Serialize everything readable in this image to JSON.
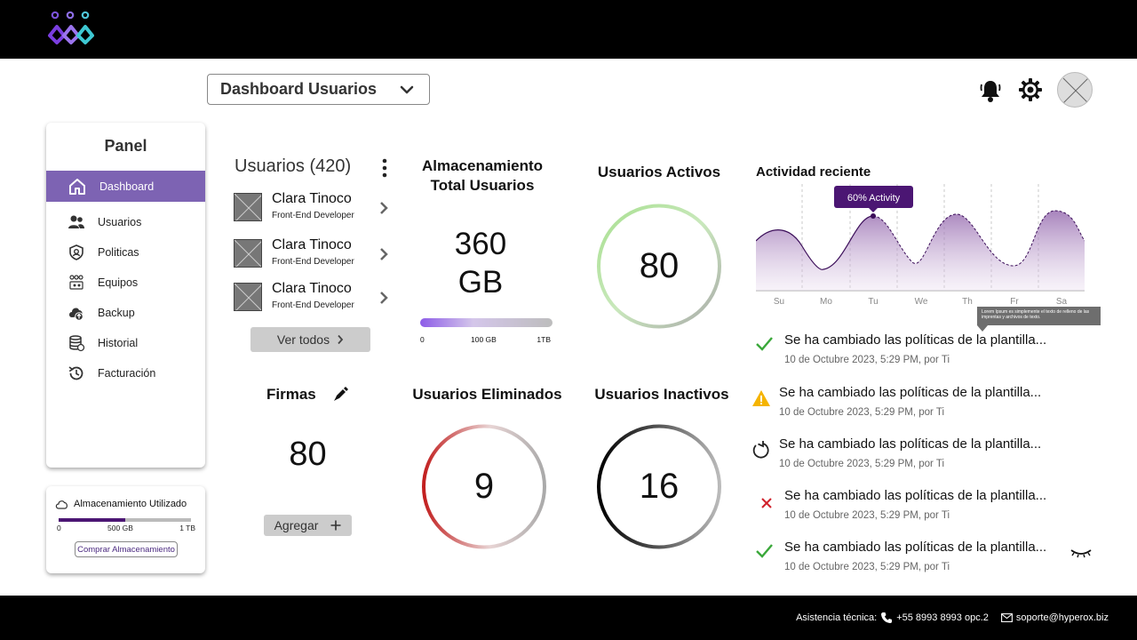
{
  "header": {
    "logo_icon": "people-logo-icon",
    "dashboard_select": "Dashboard Usuarios",
    "icons": [
      "bell-icon",
      "gear-icon",
      "avatar"
    ]
  },
  "sidebar": {
    "title": "Panel",
    "items": [
      {
        "label": "Dashboard",
        "icon": "home-icon",
        "active": true
      },
      {
        "label": "Usuarios",
        "icon": "users-icon"
      },
      {
        "label": "Politicas",
        "icon": "shield-icon"
      },
      {
        "label": "Equipos",
        "icon": "team-icon"
      },
      {
        "label": "Backup",
        "icon": "cloud-upload-icon"
      },
      {
        "label": "Historial",
        "icon": "database-icon"
      },
      {
        "label": "Facturación",
        "icon": "history-icon"
      }
    ]
  },
  "storage_used": {
    "title": "Almacenamiento Utilizado",
    "fill_fraction": 0.5,
    "ticks": [
      "0",
      "500 GB",
      "1 TB"
    ],
    "button": "Comprar Almacenamiento"
  },
  "users": {
    "title": "Usuarios (420)",
    "list": [
      {
        "name": "Clara Tinoco",
        "role": "Front-End Developer"
      },
      {
        "name": "Clara Tinoco",
        "role": "Front-End Developer"
      },
      {
        "name": "Clara Tinoco",
        "role": "Front-End Developer"
      }
    ],
    "view_all": "Ver todos"
  },
  "storage_total": {
    "title_line1": "Almacenamiento",
    "title_line2": "Total Usuarios",
    "value_line1": "360",
    "value_line2": "GB",
    "ticks": [
      "0",
      "100 GB",
      "1TB"
    ]
  },
  "active_users": {
    "title": "Usuarios Activos",
    "value": "80",
    "fraction": 1.0
  },
  "signatures": {
    "title": "Firmas",
    "value": "80",
    "button": "Agregar"
  },
  "deleted_users": {
    "title": "Usuarios Eliminados",
    "value": "9"
  },
  "inactive_users": {
    "title": "Usuarios Inactivos",
    "value": "16"
  },
  "activity": {
    "title": "Actividad reciente",
    "days": [
      "Su",
      "Mo",
      "Tu",
      "We",
      "Th",
      "Fr",
      "Sa"
    ],
    "tooltip": "60% Activity",
    "hint": "Lorem Ipsum es simplemente el texto de relleno de las imprentas y archivos de texto.",
    "log": [
      {
        "icon": "check-icon",
        "text": "Se ha cambiado las políticas de la plantilla...",
        "date": "10 de Octubre 2023, 5:29 PM, por Ti"
      },
      {
        "icon": "warning-icon",
        "text": "Se ha cambiado las políticas de la plantilla...",
        "date": "10 de Octubre 2023, 5:29 PM, por Ti"
      },
      {
        "icon": "undo-icon",
        "text": "Se ha cambiado las políticas de la plantilla...",
        "date": "10 de Octubre 2023, 5:29 PM, por Ti"
      },
      {
        "icon": "close-x-icon",
        "text": "Se ha cambiado las políticas de la plantilla...",
        "date": "10 de Octubre 2023, 5:29 PM, por Ti"
      },
      {
        "icon": "check-icon",
        "text": "Se ha cambiado las políticas de la plantilla...",
        "date": "10 de Octubre 2023, 5:29 PM, por Ti"
      }
    ]
  },
  "footer": {
    "support_label": "Asistencia técnica:",
    "phone": "+55 8993 8993 opc.2",
    "email": "soporte@hyperox.biz"
  },
  "colors": {
    "brand_purple": "#7d63b3",
    "dark_purple": "#4b1673",
    "active_green": "#9fdc8a",
    "deleted_red": "#c21f1f",
    "warning": "#f5b400"
  }
}
